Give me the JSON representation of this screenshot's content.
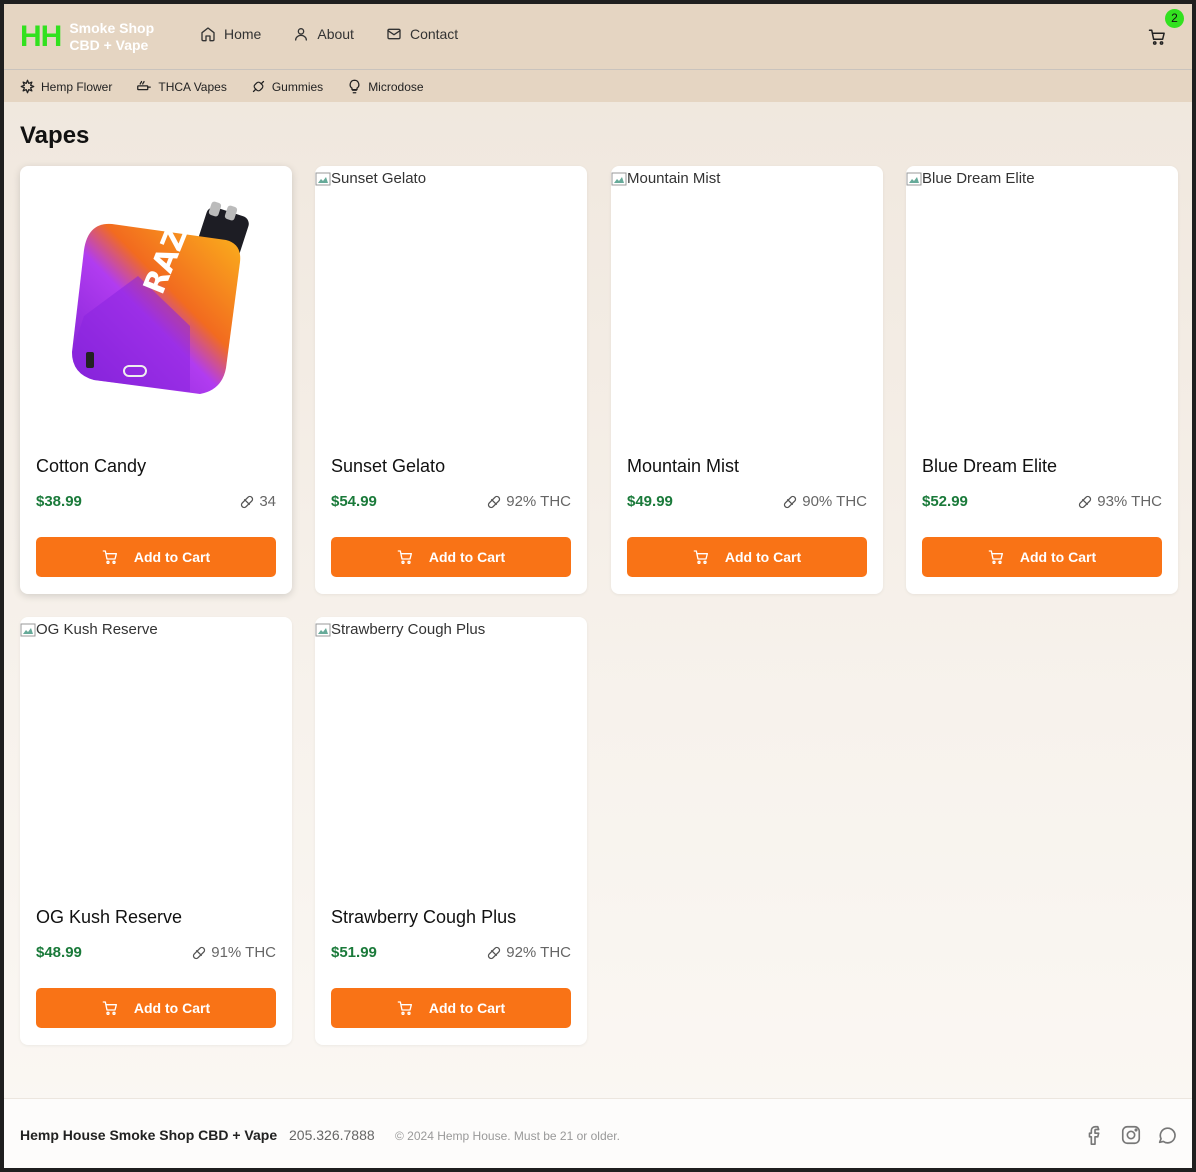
{
  "header": {
    "logo_mark": "HH",
    "logo_line1": "Smoke Shop",
    "logo_line2": "CBD + Vape",
    "nav": [
      {
        "label": "Home",
        "icon": "home-icon"
      },
      {
        "label": "About",
        "icon": "user-icon"
      },
      {
        "label": "Contact",
        "icon": "mail-icon"
      }
    ],
    "cart_count": "2"
  },
  "categories": [
    {
      "label": "Hemp Flower",
      "icon": "leaf-icon"
    },
    {
      "label": "THCA Vapes",
      "icon": "vape-icon"
    },
    {
      "label": "Gummies",
      "icon": "candy-icon"
    },
    {
      "label": "Microdose",
      "icon": "lightbulb-icon"
    }
  ],
  "page_title": "Vapes",
  "products": [
    {
      "name": "Cotton Candy",
      "price": "$38.99",
      "thc": "34",
      "image_alt": "",
      "has_image": true,
      "button": "Add to Cart"
    },
    {
      "name": "Sunset Gelato",
      "price": "$54.99",
      "thc": "92% THC",
      "image_alt": "Sunset Gelato",
      "has_image": false,
      "button": "Add to Cart"
    },
    {
      "name": "Mountain Mist",
      "price": "$49.99",
      "thc": "90% THC",
      "image_alt": "Mountain Mist",
      "has_image": false,
      "button": "Add to Cart"
    },
    {
      "name": "Blue Dream Elite",
      "price": "$52.99",
      "thc": "93% THC",
      "image_alt": "Blue Dream Elite",
      "has_image": false,
      "button": "Add to Cart"
    },
    {
      "name": "OG Kush Reserve",
      "price": "$48.99",
      "thc": "91% THC",
      "image_alt": "OG Kush Reserve",
      "has_image": false,
      "button": "Add to Cart"
    },
    {
      "name": "Strawberry Cough Plus",
      "price": "$51.99",
      "thc": "92% THC",
      "image_alt": "Strawberry Cough Plus",
      "has_image": false,
      "button": "Add to Cart"
    }
  ],
  "footer": {
    "name": "Hemp House Smoke Shop CBD + Vape",
    "phone": "205.326.7888",
    "copyright": "© 2024 Hemp House. Must be 21 or older.",
    "social": [
      "facebook-icon",
      "instagram-icon",
      "chat-icon"
    ]
  },
  "colors": {
    "accent": "#f97316",
    "logo_green": "#32e11f",
    "price_green": "#1a7a3a",
    "header_bg": "#e5d5c2"
  }
}
